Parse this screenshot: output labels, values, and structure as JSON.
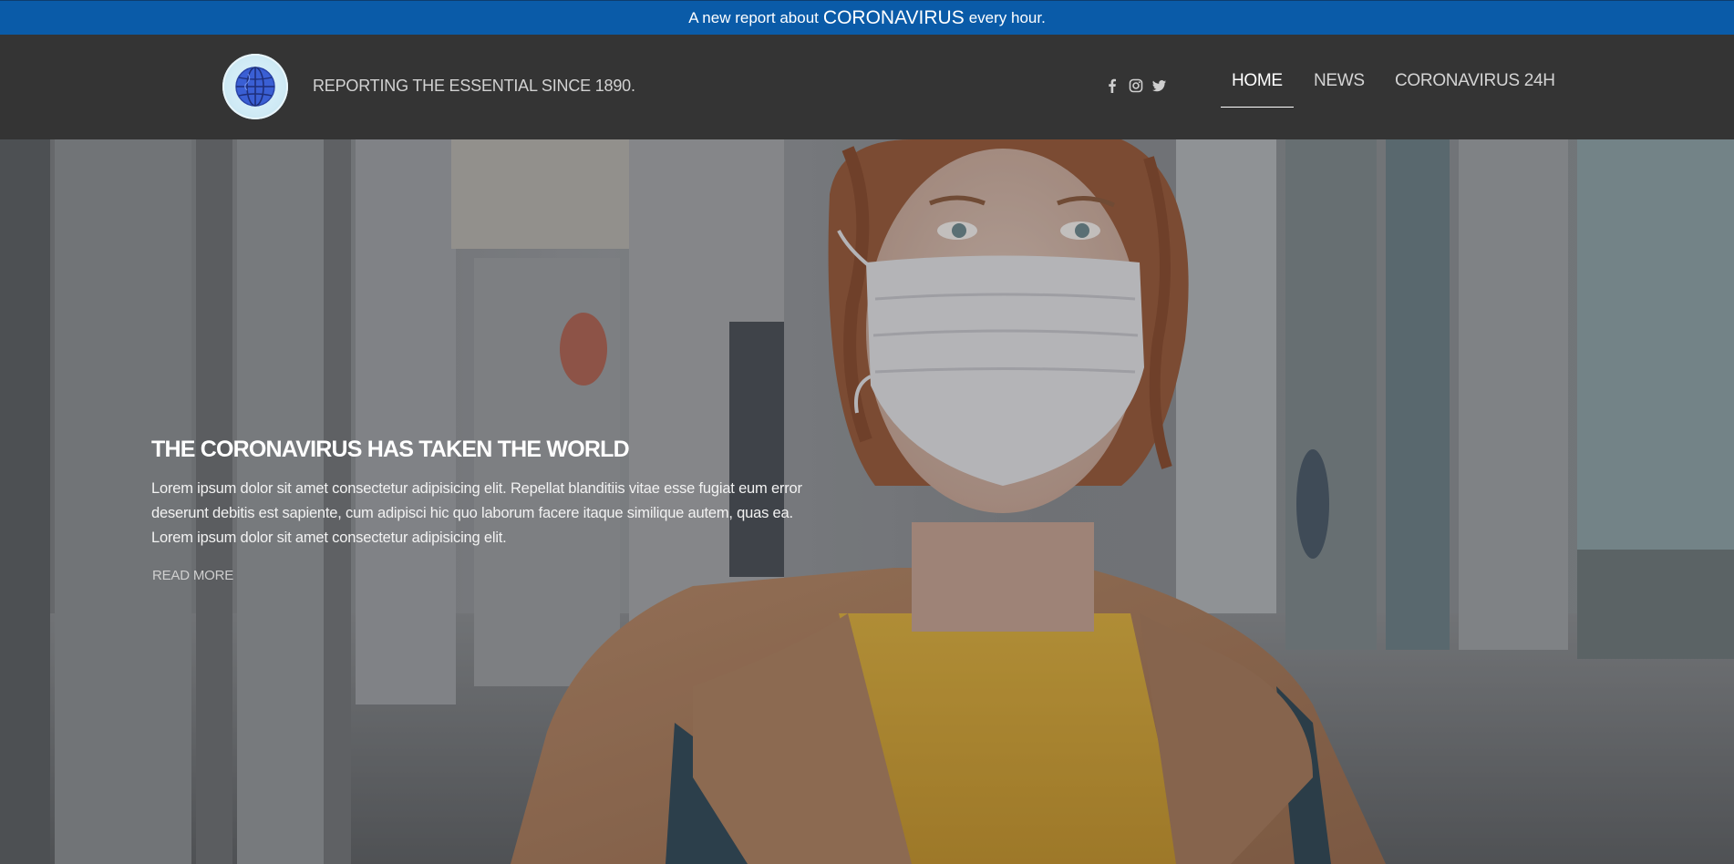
{
  "topbar": {
    "prefix": "A new report about",
    "highlight": "CORONAVIRUS",
    "suffix": "every hour."
  },
  "header": {
    "logo_icon": "globe-icon",
    "tagline": "REPORTING THE ESSENTIAL SINCE 1890.",
    "social": [
      {
        "name": "facebook-icon"
      },
      {
        "name": "instagram-icon"
      },
      {
        "name": "twitter-icon"
      }
    ],
    "nav": [
      {
        "label": "HOME",
        "active": true
      },
      {
        "label": "NEWS",
        "active": false
      },
      {
        "label": "CORONAVIRUS 24H",
        "active": false
      }
    ]
  },
  "hero": {
    "title": "THE CORONAVIRUS HAS TAKEN THE WORLD",
    "text": "Lorem ipsum dolor sit amet consectetur adipisicing elit. Repellat blanditiis vitae esse fugiat eum error deserunt debitis est sapiente, cum adipisci hic quo laborum facere itaque similique autem, quas ea. Lorem ipsum dolor sit amet consectetur adipisicing elit.",
    "cta": "READ MORE"
  },
  "colors": {
    "topbar": "#0a5ba8",
    "header": "#343434",
    "accent_text": "#ffffff"
  }
}
